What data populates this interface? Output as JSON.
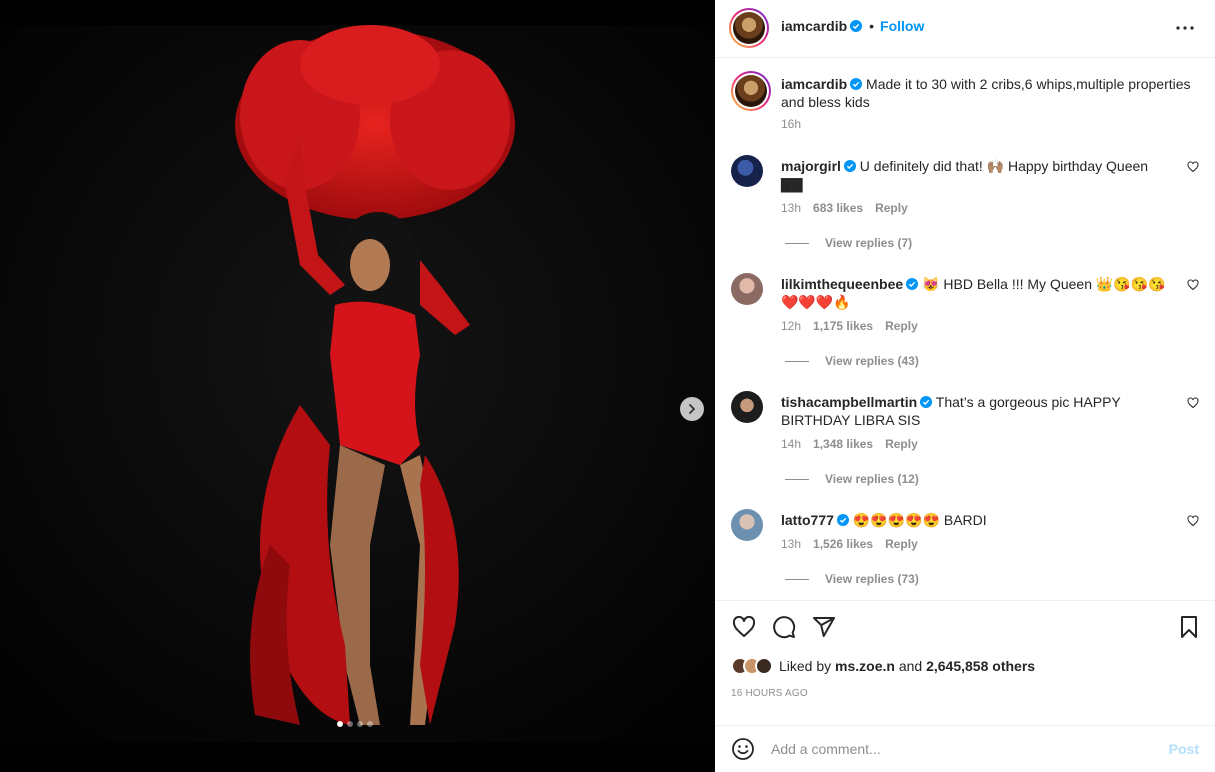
{
  "post": {
    "username": "iamcardib",
    "follow_label": "Follow",
    "bullet": "•",
    "caption": "Made it to 30 with 2 cribs,6 whips,multiple properties and bless kids",
    "caption_time": "16h",
    "carousel": {
      "count": 4,
      "active_index": 0
    }
  },
  "comments": [
    {
      "username": "majorgirl",
      "text": "U definitely did that! 🙌🏽 Happy birthday Queen ▇▇",
      "time": "13h",
      "likes": "683 likes",
      "reply": "Reply",
      "view_replies": "View replies (7)"
    },
    {
      "username": "lilkimthequeenbee",
      "text": "😻 HBD Bella !!! My Queen 👑😘😘😘❤️❤️❤️🔥",
      "time": "12h",
      "likes": "1,175 likes",
      "reply": "Reply",
      "view_replies": "View replies (43)"
    },
    {
      "username": "tishacampbellmartin",
      "text": "That’s a gorgeous pic HAPPY BIRTHDAY LIBRA SIS",
      "time": "14h",
      "likes": "1,348 likes",
      "reply": "Reply",
      "view_replies": "View replies (12)"
    },
    {
      "username": "latto777",
      "text": "😍😍😍😍😍 BARDI",
      "time": "13h",
      "likes": "1,526 likes",
      "reply": "Reply",
      "view_replies": "View replies (73)"
    }
  ],
  "likes": {
    "prefix": "Liked by",
    "user": "ms.zoe.n",
    "and": "and",
    "others": "2,645,858 others"
  },
  "timestamp": "16 HOURS AGO",
  "add_comment": {
    "placeholder": "Add a comment...",
    "post_label": "Post"
  },
  "colors": {
    "accent": "#0095f6",
    "dress": "#d4141a",
    "post_disabled": "#b2dffc"
  },
  "icons": [
    "heart-icon",
    "comment-icon",
    "share-icon",
    "bookmark-icon",
    "more-icon",
    "chevron-right-icon",
    "emoji-icon",
    "verified-badge-icon"
  ]
}
